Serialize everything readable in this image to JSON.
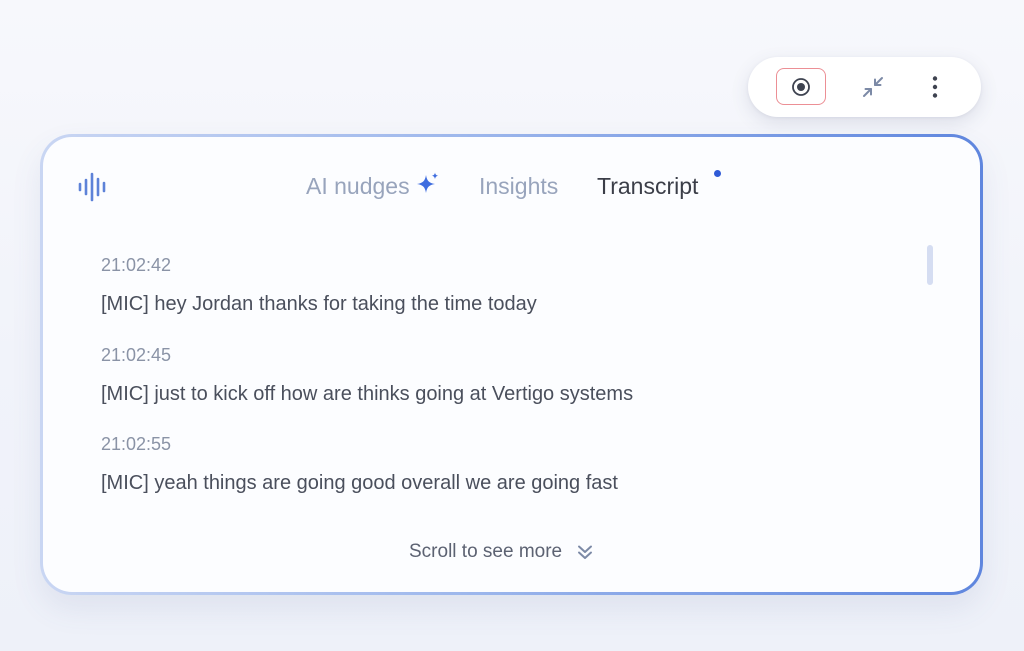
{
  "toolbar": {
    "record_icon": "record-icon",
    "minimize_icon": "minimize-icon",
    "more_icon": "more-vertical-icon"
  },
  "tabs": [
    {
      "label": "AI nudges",
      "icon": "sparkle-icon",
      "active": false
    },
    {
      "label": "Insights",
      "active": false
    },
    {
      "label": "Transcript",
      "active": true,
      "has_notification_dot": true
    }
  ],
  "transcript": [
    {
      "time": "21:02:42",
      "text": "[MIC] hey Jordan thanks for taking the time today"
    },
    {
      "time": "21:02:45",
      "text": "[MIC] just to kick off how are thinks going at Vertigo systems"
    },
    {
      "time": "21:02:55",
      "text": "[MIC] yeah things are going good overall we are going fast"
    }
  ],
  "scroll_hint": "Scroll to see more",
  "colors": {
    "accent": "#2f5ad6",
    "record_border": "#ec8f95",
    "panel_border_start": "#c9d6f3",
    "panel_border_end": "#5f86de"
  }
}
